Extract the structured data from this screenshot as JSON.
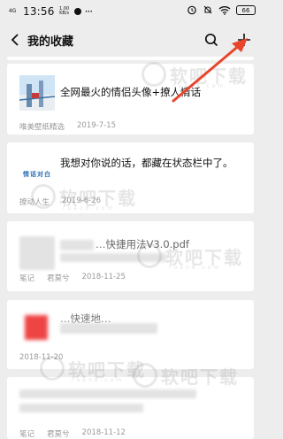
{
  "status_bar": {
    "network": "4G",
    "time": "13:56",
    "speed_value": "1.00",
    "speed_unit": "KB/s",
    "more": "···",
    "battery": "66"
  },
  "nav": {
    "title": "我的收藏"
  },
  "items": [
    {
      "title": "全网最火的情侣头像+撩人情话",
      "source": "唯美壁纸精选",
      "date": "2019-7-15"
    },
    {
      "title": "我想对你说的话，都藏在状态栏中了。",
      "thumb_text": "情话对白",
      "source": "撩动人生",
      "date": "2019-6-26"
    },
    {
      "title": "…快捷用法V3.0.pdf",
      "type": "笔记",
      "source": "君莫兮",
      "date": "2018-11-25"
    },
    {
      "title": "…快速地…",
      "date": "2018-11-20"
    },
    {
      "type": "笔记",
      "source": "君莫兮",
      "date": "2018-11-12"
    }
  ],
  "watermark": {
    "text": "软吧下载",
    "domain": "ruan8.com"
  },
  "colors": {
    "background": "#ededed",
    "card": "#ffffff",
    "arrow": "#e8452c",
    "meta": "#999999"
  }
}
